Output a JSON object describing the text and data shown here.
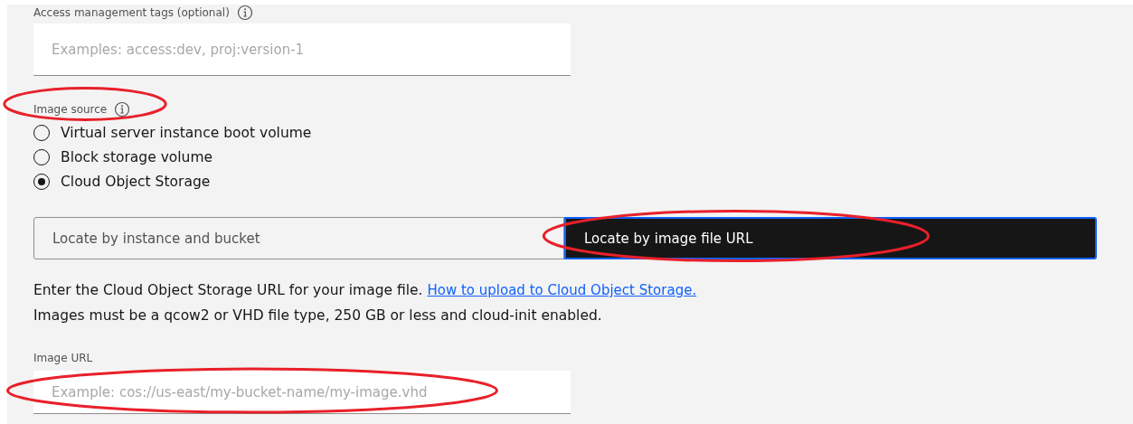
{
  "tags_field": {
    "label": "Access management tags (optional)",
    "placeholder": "Examples: access:dev, proj:version-1"
  },
  "image_source": {
    "label": "Image source",
    "highlighted": true,
    "options": [
      {
        "label": "Virtual server instance boot volume",
        "selected": false
      },
      {
        "label": "Block storage volume",
        "selected": false
      },
      {
        "label": "Cloud Object Storage",
        "selected": true
      }
    ]
  },
  "locate_switch": [
    {
      "label": "Locate by instance and bucket",
      "selected": false,
      "highlighted": false
    },
    {
      "label": "Locate by image file URL",
      "selected": true,
      "highlighted": true
    }
  ],
  "help_text": {
    "intro": "Enter the Cloud Object Storage URL for your image file.",
    "link": "How to upload to Cloud Object Storage.",
    "requirements": "Images must be a qcow2 or VHD file type, 250 GB or less and cloud-init enabled."
  },
  "url_field": {
    "label": "Image URL",
    "placeholder": "Example: cos://us-east/my-bucket-name/my-image.vhd",
    "highlighted": true
  }
}
